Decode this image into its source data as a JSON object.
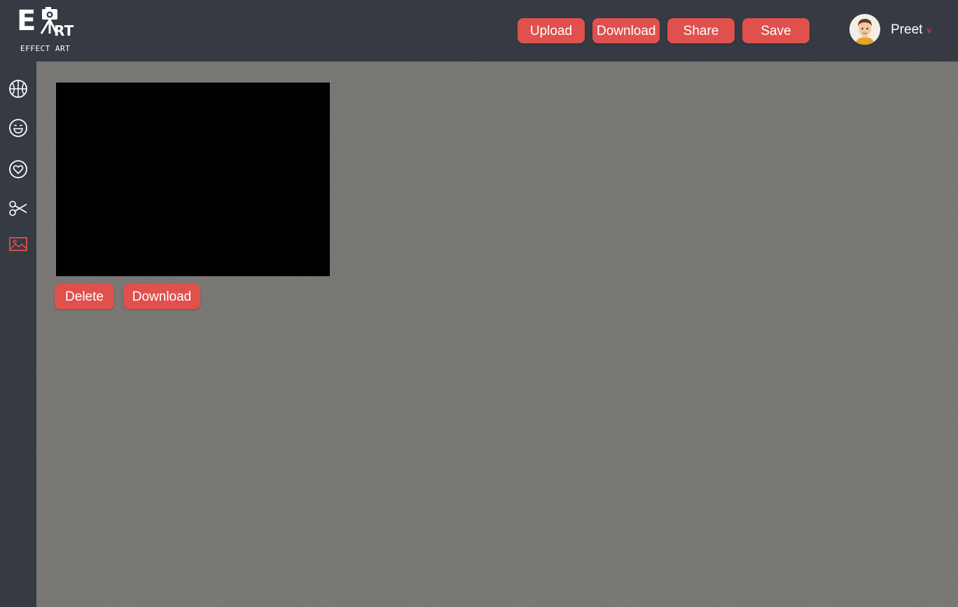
{
  "brand": {
    "logo_mark": "EART",
    "logo_caption": "EFFECT ART"
  },
  "header": {
    "buttons": {
      "upload": "Upload",
      "download": "Download",
      "share": "Share",
      "save": "Save"
    },
    "user": {
      "name": "Preet",
      "caret": "v"
    }
  },
  "sidebar": {
    "items": [
      {
        "icon": "basketball-icon",
        "active": false
      },
      {
        "icon": "smiley-icon",
        "active": false
      },
      {
        "icon": "heart-icon",
        "active": false
      },
      {
        "icon": "scissors-icon",
        "active": false
      },
      {
        "icon": "image-icon",
        "active": true
      }
    ]
  },
  "workspace": {
    "actions": {
      "delete": "Delete",
      "download": "Download"
    }
  },
  "colors": {
    "accent": "#e0504c",
    "chrome": "#363a42",
    "canvas": "#7c7b78",
    "active_icon": "#e0504c",
    "icon": "#ffffff"
  }
}
